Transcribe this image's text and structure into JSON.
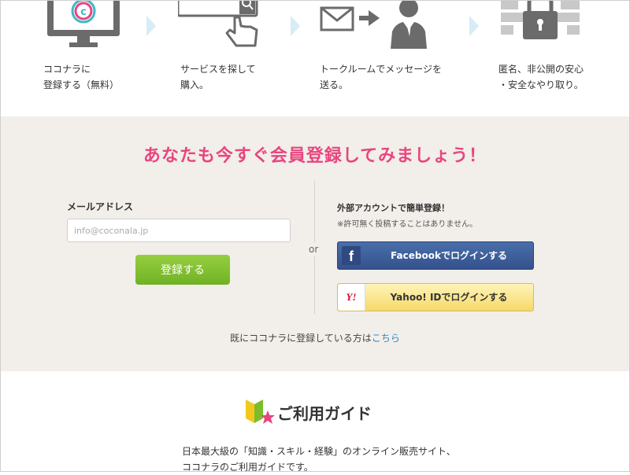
{
  "steps": [
    {
      "text": "ココナラに\n登録する（無料）",
      "icon": "monitor-logo-icon"
    },
    {
      "text": "サービスを探して\n購入。",
      "icon": "search-click-icon"
    },
    {
      "text": "トークルームでメッセージを\n送る。",
      "icon": "mail-to-person-icon"
    },
    {
      "text": "匿名、非公開の安心\n・安全なやり取り。",
      "icon": "lock-icon"
    }
  ],
  "signup": {
    "heading": "あなたも今すぐ会員登録してみましょう！",
    "email_label": "メールアドレス",
    "email_placeholder": "info@coconala.jp",
    "register_label": "登録する",
    "or_text": "or",
    "external_title": "外部アカウントで簡単登録！",
    "external_note": "※許可無く投稿することはありません。",
    "facebook_label": "Facebookでログインする",
    "facebook_logo": "f",
    "yahoo_label": "Yahoo! IDでログインする",
    "yahoo_logo": "Y!",
    "login_prefix": "既にココナラに登録している方は",
    "login_link": "こちら"
  },
  "guide": {
    "title": "ご利用ガイド",
    "description": "日本最大級の「知識・スキル・経験」のオンライン販売サイト、\nココナラのご利用ガイドです。"
  },
  "colors": {
    "accent_pink": "#e8457f",
    "signup_bg": "#f2eeea",
    "register_green": "#7cbd2b",
    "facebook_blue": "#3b5998",
    "yahoo_yellow": "#f8e27a",
    "link_blue": "#2a8ac9"
  }
}
